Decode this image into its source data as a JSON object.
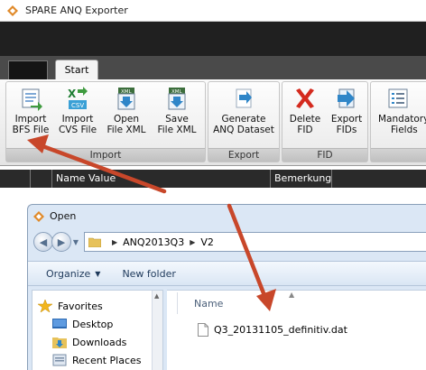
{
  "app": {
    "title": "SPARE ANQ Exporter",
    "tab_start": "Start"
  },
  "ribbon": {
    "groups": [
      {
        "caption": "Import",
        "buttons": [
          {
            "line1": "Import",
            "line2": "BFS File"
          },
          {
            "line1": "Import",
            "line2": "CVS File"
          },
          {
            "line1": "Open",
            "line2": "File XML"
          },
          {
            "line1": "Save",
            "line2": "File XML"
          }
        ]
      },
      {
        "caption": "Export",
        "buttons": [
          {
            "line1": "Generate",
            "line2": "ANQ Dataset"
          }
        ]
      },
      {
        "caption": "FID",
        "buttons": [
          {
            "line1": "Delete",
            "line2": "FID"
          },
          {
            "line1": "Export",
            "line2": "FIDs"
          }
        ]
      },
      {
        "caption": "",
        "buttons": [
          {
            "line1": "Mandatory",
            "line2": "Fields"
          }
        ]
      }
    ],
    "icon_labels": {
      "csv": "CSV",
      "xml": "XML"
    }
  },
  "grid": {
    "columns": [
      "Name",
      "Value",
      "Bemerkung"
    ]
  },
  "dialog": {
    "title": "Open",
    "path": [
      "ANQ2013Q3",
      "V2"
    ],
    "organize_label": "Organize",
    "new_folder_label": "New folder",
    "nav": {
      "favorites": "Favorites",
      "desktop": "Desktop",
      "downloads": "Downloads",
      "recent": "Recent Places"
    },
    "column_name": "Name",
    "files": [
      "Q3_20131105_definitiv.dat"
    ]
  },
  "colors": {
    "annotation_arrow": "#c8472a",
    "dark_band": "#202020",
    "dialog_frame": "#dbe7f5"
  }
}
